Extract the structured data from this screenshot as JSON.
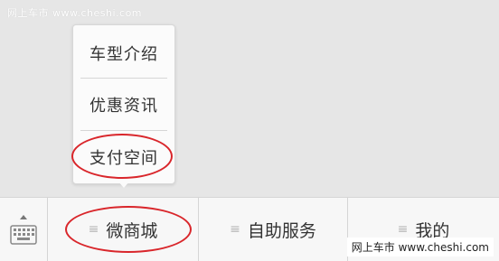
{
  "watermark": {
    "top": "网上车市 www.cheshi.com",
    "bottom": "网上车市 www.cheshi.com"
  },
  "popup_menu": {
    "items": [
      {
        "label": "车型介绍"
      },
      {
        "label": "优惠资讯"
      },
      {
        "label": "支付空间"
      }
    ]
  },
  "bottom_bar": {
    "keyboard_icon": "keyboard-icon",
    "tabs": [
      {
        "label": "微商城",
        "icon": "menu-lines-icon"
      },
      {
        "label": "自助服务",
        "icon": "menu-lines-icon"
      },
      {
        "label": "我的",
        "icon": "menu-lines-icon"
      }
    ]
  },
  "colors": {
    "annotation": "#d9262b",
    "background": "#e6e6e6",
    "bar": "#f7f7f7"
  }
}
